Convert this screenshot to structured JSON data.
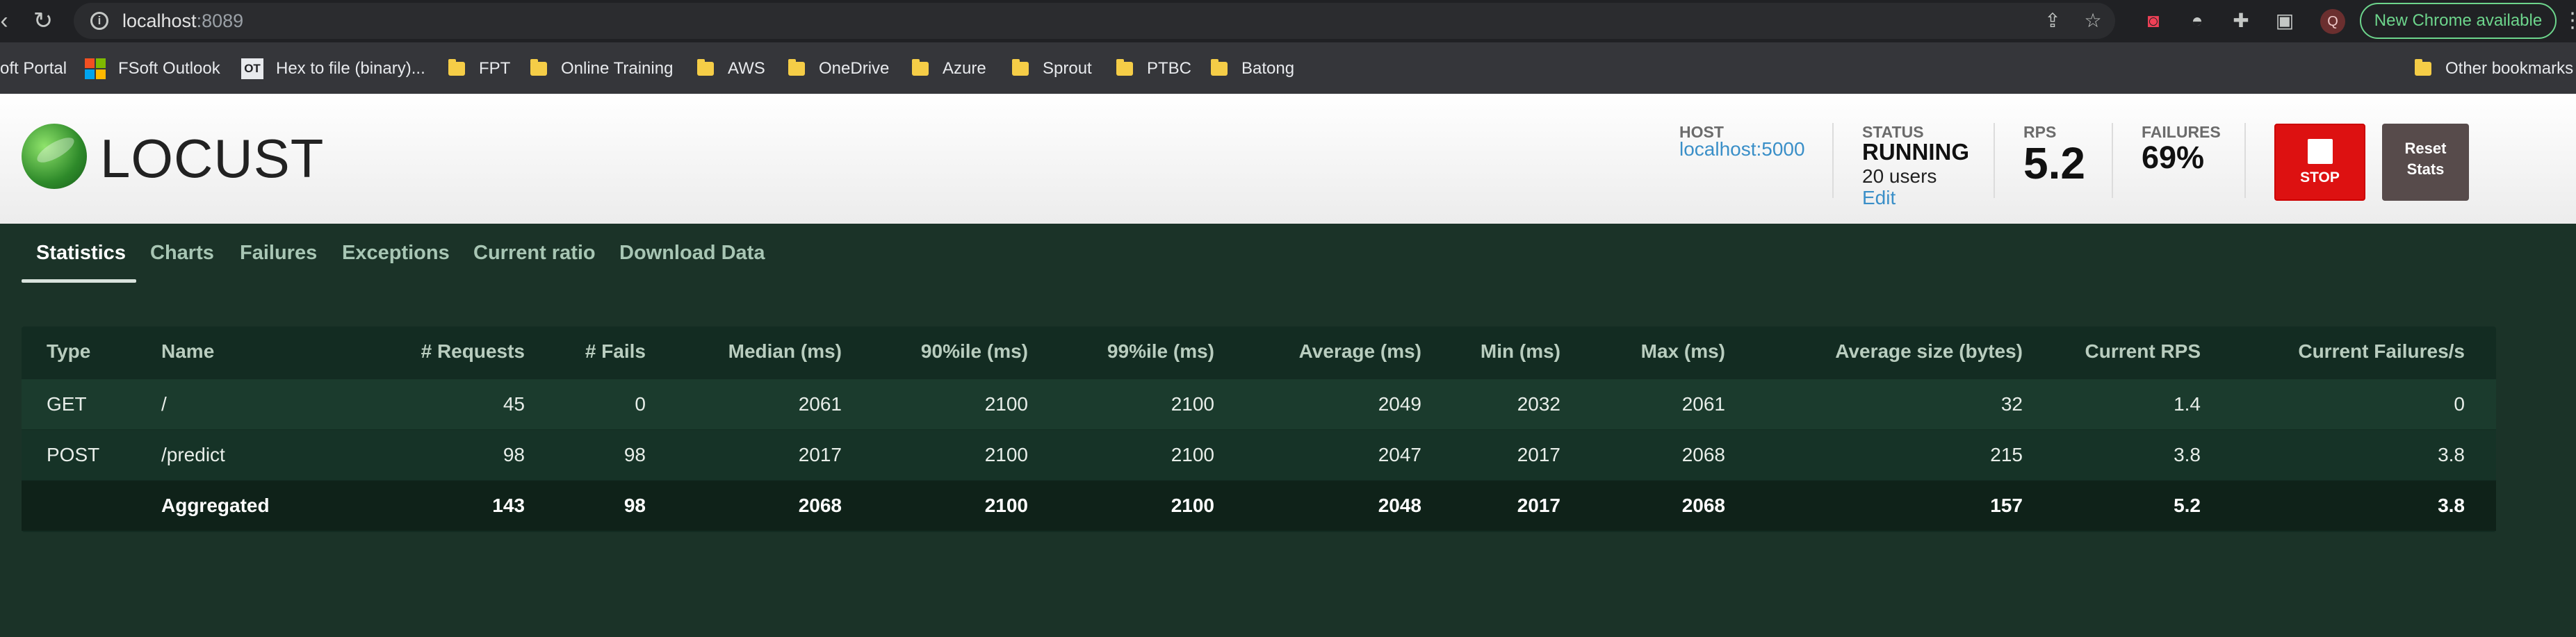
{
  "browser": {
    "url_host": "localhost",
    "url_port": ":8089",
    "new_chrome_label": "New Chrome available",
    "avatar_letter": "Q"
  },
  "bookmarks": [
    {
      "label": "oft Portal"
    },
    {
      "label": "FSoft Outlook"
    },
    {
      "label": "Hex to file (binary)..."
    },
    {
      "label": "FPT"
    },
    {
      "label": "Online Training"
    },
    {
      "label": "AWS"
    },
    {
      "label": "OneDrive"
    },
    {
      "label": "Azure"
    },
    {
      "label": "Sprout"
    },
    {
      "label": "PTBC"
    },
    {
      "label": "Batong"
    },
    {
      "label": "Other bookmarks"
    }
  ],
  "app": {
    "logo_text": "LOCUST",
    "host_label": "HOST",
    "host_value": "localhost:5000",
    "status_label": "STATUS",
    "status_value": "RUNNING",
    "users_value": "20 users",
    "edit_label": "Edit",
    "rps_label": "RPS",
    "rps_value": "5.2",
    "failures_label": "FAILURES",
    "failures_value": "69%",
    "stop_label": "STOP",
    "reset_label_1": "Reset",
    "reset_label_2": "Stats",
    "stop_color": "#dd1111",
    "reset_color": "#574b4b"
  },
  "tabs": [
    {
      "label": "Statistics",
      "active": true
    },
    {
      "label": "Charts"
    },
    {
      "label": "Failures"
    },
    {
      "label": "Exceptions"
    },
    {
      "label": "Current ratio"
    },
    {
      "label": "Download Data"
    }
  ],
  "table": {
    "headers": [
      "Type",
      "Name",
      "# Requests",
      "# Fails",
      "Median (ms)",
      "90%ile (ms)",
      "99%ile (ms)",
      "Average (ms)",
      "Min (ms)",
      "Max (ms)",
      "Average size (bytes)",
      "Current RPS",
      "Current Failures/s"
    ],
    "rows": [
      [
        "GET",
        "/",
        "45",
        "0",
        "2061",
        "2100",
        "2100",
        "2049",
        "2032",
        "2061",
        "32",
        "1.4",
        "0"
      ],
      [
        "POST",
        "/predict",
        "98",
        "98",
        "2017",
        "2100",
        "2100",
        "2047",
        "2017",
        "2068",
        "215",
        "3.8",
        "3.8"
      ],
      [
        "",
        "Aggregated",
        "143",
        "98",
        "2068",
        "2100",
        "2100",
        "2048",
        "2017",
        "2068",
        "157",
        "5.2",
        "3.8"
      ]
    ]
  }
}
